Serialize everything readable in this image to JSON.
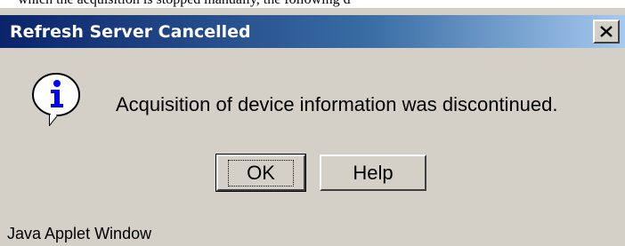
{
  "background_text": "which the acquisition is stopped manually, the following d",
  "dialog": {
    "title": "Refresh Server Cancelled",
    "message": "Acquisition of device information was discontinued.",
    "ok_label": "OK",
    "help_label": "Help",
    "footer": "Java Applet Window",
    "icon": "info-icon",
    "close_icon": "close-icon",
    "colors": {
      "title_bar_start": "#0a246a",
      "title_bar_end": "#a6caf0",
      "window_bg": "#d4d0c8",
      "icon_blue": "#0000ff"
    }
  }
}
